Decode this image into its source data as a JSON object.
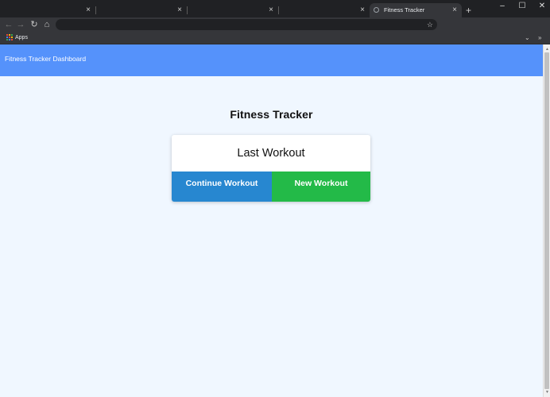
{
  "browser": {
    "tabs": [
      {
        "title": "",
        "active": false
      },
      {
        "title": "",
        "active": false
      },
      {
        "title": "",
        "active": false
      },
      {
        "title": "",
        "active": false
      },
      {
        "title": "Fitness Tracker",
        "active": true
      }
    ],
    "close_glyph": "×",
    "new_tab_glyph": "+",
    "window_controls": {
      "minimize": "–",
      "maximize": "☐",
      "close": "✕"
    },
    "nav": {
      "back": "←",
      "forward": "→",
      "reload": "↻",
      "home": "⌂"
    },
    "address_value": "",
    "star_glyph": "☆",
    "bookmarks": {
      "apps_label": "Apps",
      "overflow": "»",
      "more": "⌄"
    }
  },
  "app": {
    "brand": "Fitness Tracker Dashboard",
    "page_title": "Fitness Tracker",
    "card_title": "Last Workout",
    "continue_label": "Continue Workout",
    "new_label": "New Workout"
  },
  "colors": {
    "navbar": "#5592fb",
    "page_bg": "#f0f7ff",
    "continue_btn": "#2787d0",
    "new_btn": "#23ba48"
  }
}
